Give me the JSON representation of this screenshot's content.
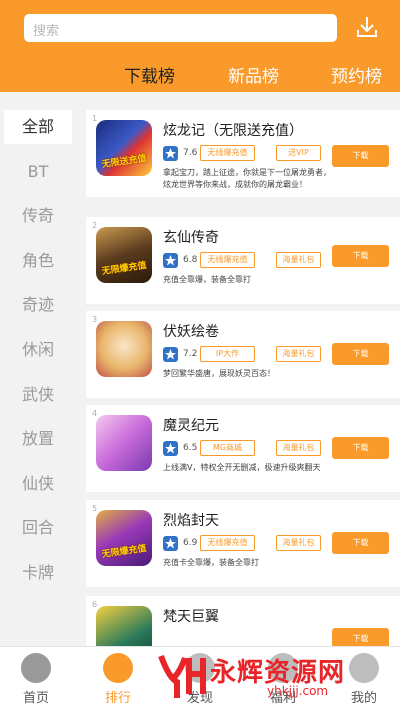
{
  "search": {
    "placeholder": "搜索"
  },
  "tabs": [
    "下载榜",
    "新品榜",
    "预约榜"
  ],
  "sidebar": [
    "全部",
    "BT",
    "传奇",
    "角色",
    "奇迹",
    "休闲",
    "武侠",
    "放置",
    "仙侠",
    "回合",
    "卡牌"
  ],
  "games": [
    {
      "idx": "1",
      "name": "炫龙记（无限送充值）",
      "score": "7.6",
      "tag1": "无线爆充值",
      "tag2": "送VIP",
      "desc": "拿起宝刀，踏上征途，你就是下一位屠龙勇者，炫龙世界等你来战，成就你的屠龙霸业！",
      "button": "下载",
      "badge": "无限送充值",
      "colors": [
        "#2a3a8a",
        "#d33"
      ]
    },
    {
      "idx": "2",
      "name": "玄仙传奇",
      "score": "6.8",
      "tag1": "无线爆充值",
      "tag2": "海量礼包",
      "desc": "充值全靠爆，装备全靠打",
      "button": "下载",
      "badge": "无限爆充值",
      "colors": [
        "#5a3b1e",
        "#c98a3a"
      ]
    },
    {
      "idx": "3",
      "name": "伏妖绘卷",
      "score": "7.2",
      "tag1": "IP大作",
      "tag2": "海量礼包",
      "desc": "梦回繁华盛唐，展现妖灵百态！",
      "button": "下载",
      "badge": "",
      "colors": [
        "#e8b56a",
        "#f5e0c0"
      ]
    },
    {
      "idx": "4",
      "name": "魔灵纪元",
      "score": "6.5",
      "tag1": "MG商城",
      "tag2": "海量礼包",
      "desc": "上线满V，特权全开无删减，极速升级爽翻天",
      "button": "下载",
      "badge": "",
      "colors": [
        "#c86ad9",
        "#f4c9f0"
      ]
    },
    {
      "idx": "5",
      "name": "烈焰封天",
      "score": "6.9",
      "tag1": "无线爆充值",
      "tag2": "海量礼包",
      "desc": "充值卡全靠爆，装备全靠打",
      "button": "下载",
      "badge": "无限爆充值",
      "colors": [
        "#7a2ba8",
        "#e0b040"
      ]
    },
    {
      "idx": "6",
      "name": "梵天巨翼",
      "score": "",
      "tag1": "",
      "tag2": "",
      "desc": "",
      "button": "下载",
      "badge": "",
      "colors": [
        "#2a7a5a",
        "#e8c040"
      ]
    }
  ],
  "bottom_nav": [
    "首页",
    "排行",
    "发现",
    "福利",
    "我的"
  ],
  "watermark": {
    "title": "永辉资源网",
    "url": "yhkjjj.com"
  },
  "theme": {
    "accent": "#f99a2b"
  }
}
